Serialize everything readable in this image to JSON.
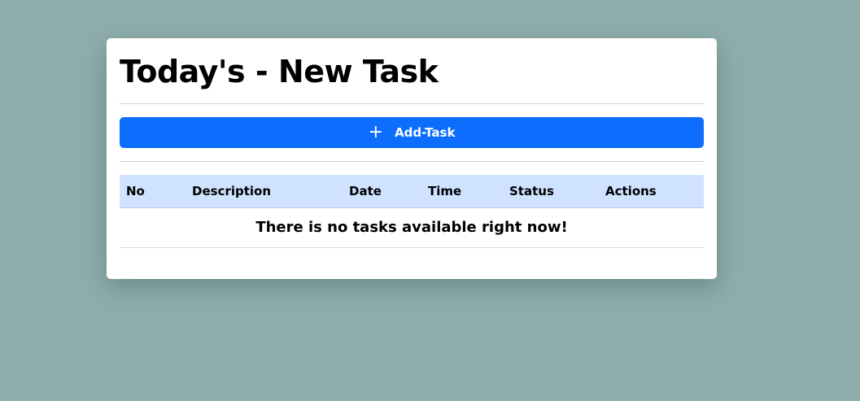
{
  "header": {
    "title": "Today's - New Task"
  },
  "toolbar": {
    "add_label": "Add-Task",
    "add_icon": "plus-icon"
  },
  "table": {
    "columns": [
      "No",
      "Description",
      "Date",
      "Time",
      "Status",
      "Actions"
    ],
    "rows": [],
    "empty_message": "There is no tasks available right now!"
  },
  "colors": {
    "background": "#8fadad",
    "primary_button": "#0d6efd",
    "table_header": "#cfe2ff"
  }
}
